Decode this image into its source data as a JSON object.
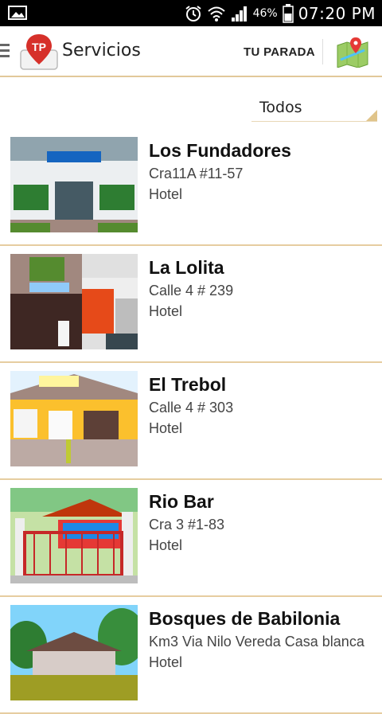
{
  "status_bar": {
    "battery_percent": "46%",
    "time": "07:20 PM",
    "icons": [
      "image-icon",
      "alarm-icon",
      "wifi-icon",
      "signal-icon",
      "battery-icon"
    ]
  },
  "app_bar": {
    "title": "Servicios",
    "logo_text": "TP",
    "tu_parada_label": "TU PARADA",
    "icons": [
      "menu-icon",
      "map-icon"
    ]
  },
  "filter": {
    "selected": "Todos"
  },
  "items": [
    {
      "name": "Los Fundadores",
      "address": "Cra11A #11-57",
      "category": "Hotel"
    },
    {
      "name": "La Lolita",
      "address": "Calle 4 # 239",
      "category": "Hotel"
    },
    {
      "name": "El Trebol",
      "address": "Calle 4 # 303",
      "category": "Hotel"
    },
    {
      "name": "Rio Bar",
      "address": "Cra 3 #1-83",
      "category": "Hotel"
    },
    {
      "name": "Bosques de Babilonia",
      "address": "Km3 Via Nilo Vereda Casa blanca",
      "category": "Hotel"
    }
  ],
  "colors": {
    "accent_border": "#e6cda0",
    "logo_red": "#d6302a"
  }
}
